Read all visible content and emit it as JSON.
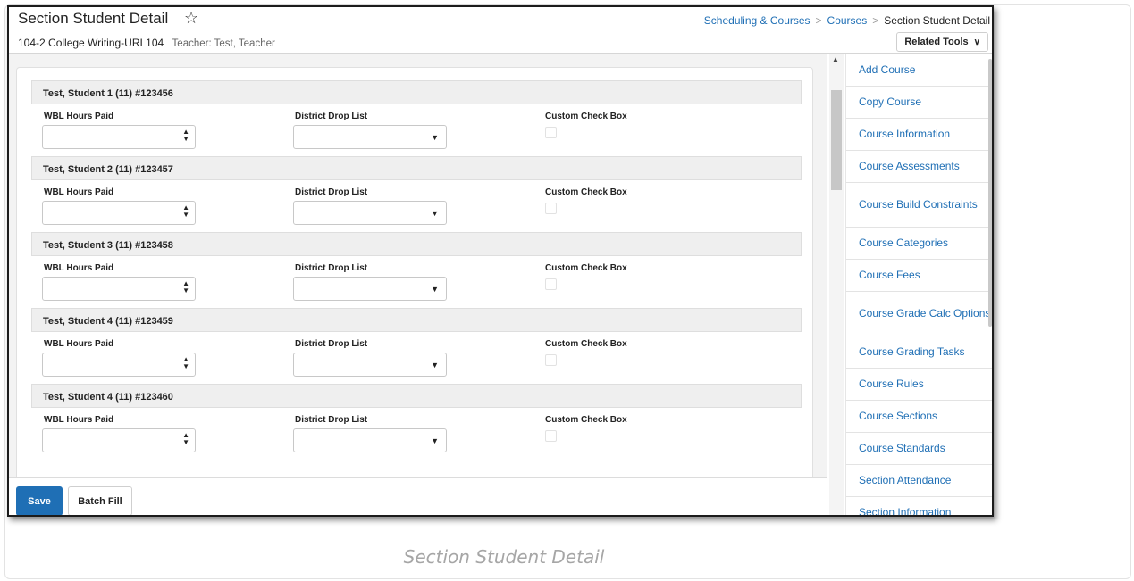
{
  "header": {
    "title": "Section Student Detail",
    "section": "104-2 College Writing-URI 104",
    "teacher": "Teacher: Test, Teacher",
    "breadcrumb": [
      "Scheduling & Courses",
      "Courses",
      "Section Student Detail"
    ],
    "breadcrumb_sep": ">",
    "related_tools": "Related Tools",
    "star_glyph": "☆",
    "chevron_glyph": "∨"
  },
  "fields": {
    "hours": "WBL Hours Paid",
    "drop": "District Drop List",
    "check": "Custom Check Box"
  },
  "students": [
    {
      "name": "Test, Student 1 (11) #123456"
    },
    {
      "name": "Test, Student 2 (11) #123457"
    },
    {
      "name": "Test, Student 3 (11) #123458"
    },
    {
      "name": "Test, Student 4 (11) #123459"
    },
    {
      "name": "Test, Student 4 (11) #123460"
    }
  ],
  "sidebar": {
    "items": [
      "Add Course",
      "Copy Course",
      "Course Information",
      "Course Assessments",
      "Course Build Constraints",
      "Course Categories",
      "Course Fees",
      "Course Grade Calc Options",
      "Course Grading Tasks",
      "Course Rules",
      "Course Sections",
      "Course Standards",
      "Section Attendance",
      "Section Information"
    ]
  },
  "footer": {
    "save": "Save",
    "batch_fill": "Batch Fill"
  },
  "caption": "Section Student Detail",
  "colors": {
    "accent": "#1f6fb5",
    "header_bg": "#efefef"
  },
  "icons": {
    "spinner": "▲▼",
    "caret": "▼",
    "scroll_up": "▲"
  }
}
